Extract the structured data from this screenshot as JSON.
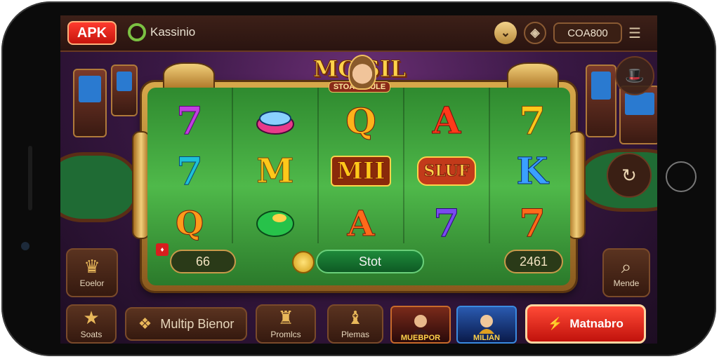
{
  "topbar": {
    "apk_label": "APK",
    "brand_name": "Kassinio",
    "credit_value": "COA800",
    "icons": [
      "chevron-down-icon",
      "diamond-icon",
      "menu-icon"
    ]
  },
  "game": {
    "title": "MC  SIL",
    "subtitle": "STOAE GIULE",
    "reels": [
      [
        "7",
        "7",
        "Q"
      ],
      [
        "gem",
        "M",
        "emerald"
      ],
      [
        "Q",
        "MII",
        "A"
      ],
      [
        "A",
        "SLUF",
        "7"
      ],
      [
        "7",
        "K",
        "7"
      ]
    ],
    "bet_value": "66",
    "spin_label": "Stot",
    "win_value": "2461"
  },
  "side_left": [
    {
      "label": "Eoelor",
      "icon": "crown-icon"
    }
  ],
  "side_right": [
    {
      "label": "",
      "icon": "hat-icon"
    },
    {
      "label": "",
      "icon": "refresh-icon"
    },
    {
      "label": "Mende",
      "icon": "search-icon"
    }
  ],
  "bottom": {
    "star_tile_label": "Soats",
    "wide_tile_label": "Multip Bienor",
    "promo_tile_label": "Promlcs",
    "games_tile_label": "Plemas",
    "thumb1_label": "MUEBPOR",
    "thumb2_label": "MILIAN",
    "cta_label": "Matnabro"
  },
  "colors": {
    "felt_green": "#3fae44",
    "gold": "#ffd24a",
    "cta_red": "#e0261c"
  }
}
